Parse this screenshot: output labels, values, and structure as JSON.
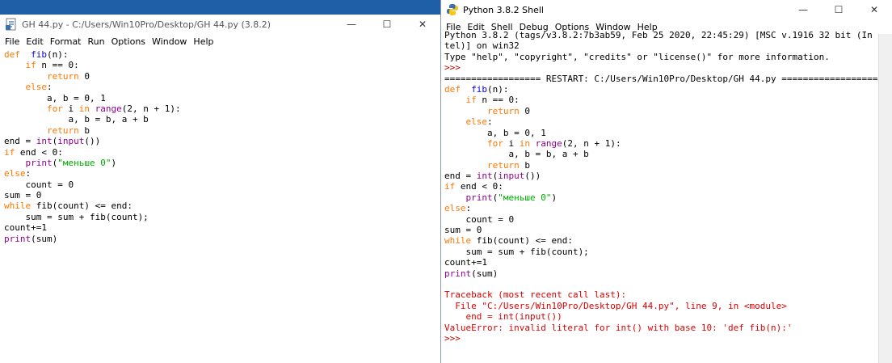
{
  "editor": {
    "title": "GH 44.py - C:/Users/Win10Pro/Desktop/GH 44.py (3.8.2)",
    "menu": [
      "File",
      "Edit",
      "Format",
      "Run",
      "Options",
      "Window",
      "Help"
    ],
    "controls": {
      "minimize": "—",
      "maximize": "☐",
      "close": "✕"
    },
    "code": [
      [
        [
          "kw",
          "def"
        ],
        [
          "",
          "  "
        ],
        [
          "fn",
          "fib"
        ],
        [
          "",
          "(n):"
        ]
      ],
      [
        [
          "",
          "    "
        ],
        [
          "kw",
          "if"
        ],
        [
          "",
          ""
        ],
        [
          "",
          " n == 0:"
        ]
      ],
      [
        [
          "",
          "        "
        ],
        [
          "kw",
          "return"
        ],
        [
          "",
          " 0"
        ]
      ],
      [
        [
          "",
          "    "
        ],
        [
          "kw",
          "else"
        ],
        [
          "",
          ":"
        ]
      ],
      [
        [
          "",
          "        a, b = 0, 1"
        ]
      ],
      [
        [
          "",
          "        "
        ],
        [
          "kw",
          "for"
        ],
        [
          "",
          " i "
        ],
        [
          "kw",
          "in"
        ],
        [
          "",
          " "
        ],
        [
          "bi",
          "range"
        ],
        [
          "",
          "(2, n + 1):"
        ]
      ],
      [
        [
          "",
          "            a, b = b, a + b"
        ]
      ],
      [
        [
          "",
          "        "
        ],
        [
          "kw",
          "return"
        ],
        [
          "",
          " b"
        ]
      ],
      [
        [
          "",
          "end = "
        ],
        [
          "bi",
          "int"
        ],
        [
          "",
          "("
        ],
        [
          "bi",
          "input"
        ],
        [
          "",
          "())"
        ]
      ],
      [
        [
          "kw",
          "if"
        ],
        [
          "",
          " end < 0:"
        ]
      ],
      [
        [
          "",
          "    "
        ],
        [
          "bi",
          "print"
        ],
        [
          "",
          "("
        ],
        [
          "st",
          "\"меньше 0\""
        ],
        [
          "",
          ")"
        ]
      ],
      [
        [
          "kw",
          "else"
        ],
        [
          "",
          ":"
        ]
      ],
      [
        [
          "",
          "    count = 0"
        ]
      ],
      [
        [
          "",
          "sum = 0"
        ]
      ],
      [
        [
          "kw",
          "while"
        ],
        [
          "",
          " fib(count) <= end:"
        ]
      ],
      [
        [
          "",
          "    sum = sum + fib(count);"
        ]
      ],
      [
        [
          "",
          "count+=1"
        ]
      ],
      [
        [
          "bi",
          "print"
        ],
        [
          "",
          "(sum)"
        ]
      ]
    ]
  },
  "shell": {
    "title": "Python 3.8.2 Shell",
    "menu": [
      "File",
      "Edit",
      "Shell",
      "Debug",
      "Options",
      "Window",
      "Help"
    ],
    "controls": {
      "minimize": "—",
      "maximize": "☐",
      "close": "✕"
    },
    "output": [
      [
        [
          "",
          "Python 3.8.2 (tags/v3.8.2:7b3ab59, Feb 25 2020, 22:45:29) [MSC v.1916 32 bit (In"
        ]
      ],
      [
        [
          "",
          "tel)] on win32"
        ]
      ],
      [
        [
          "",
          "Type \"help\", \"copyright\", \"credits\" or \"license()\" for more information."
        ]
      ],
      [
        [
          "pr",
          ">>> "
        ]
      ],
      [
        [
          "",
          "================== RESTART: C:/Users/Win10Pro/Desktop/GH 44.py =================="
        ]
      ],
      [
        [
          "kw",
          "def"
        ],
        [
          "",
          "  "
        ],
        [
          "fn",
          "fib"
        ],
        [
          "",
          "(n):"
        ]
      ],
      [
        [
          "",
          "    "
        ],
        [
          "kw",
          "if"
        ],
        [
          "",
          " n == 0:"
        ]
      ],
      [
        [
          "",
          "        "
        ],
        [
          "kw",
          "return"
        ],
        [
          "",
          " 0"
        ]
      ],
      [
        [
          "",
          "    "
        ],
        [
          "kw",
          "else"
        ],
        [
          "",
          ":"
        ]
      ],
      [
        [
          "",
          "        a, b = 0, 1"
        ]
      ],
      [
        [
          "",
          "        "
        ],
        [
          "kw",
          "for"
        ],
        [
          "",
          " i "
        ],
        [
          "kw",
          "in"
        ],
        [
          "",
          " "
        ],
        [
          "bi",
          "range"
        ],
        [
          "",
          "(2, n + 1):"
        ]
      ],
      [
        [
          "",
          "            a, b = b, a + b"
        ]
      ],
      [
        [
          "",
          "        "
        ],
        [
          "kw",
          "return"
        ],
        [
          "",
          " b"
        ]
      ],
      [
        [
          "",
          "end = "
        ],
        [
          "bi",
          "int"
        ],
        [
          "",
          "("
        ],
        [
          "bi",
          "input"
        ],
        [
          "",
          "())"
        ]
      ],
      [
        [
          "kw",
          "if"
        ],
        [
          "",
          " end < 0:"
        ]
      ],
      [
        [
          "",
          "    "
        ],
        [
          "bi",
          "print"
        ],
        [
          "",
          "("
        ],
        [
          "st",
          "\"меньше 0\""
        ],
        [
          "",
          ")"
        ]
      ],
      [
        [
          "kw",
          "else"
        ],
        [
          "",
          ":"
        ]
      ],
      [
        [
          "",
          "    count = 0"
        ]
      ],
      [
        [
          "",
          "sum = 0"
        ]
      ],
      [
        [
          "kw",
          "while"
        ],
        [
          "",
          " fib(count) <= end:"
        ]
      ],
      [
        [
          "",
          "    sum = sum + fib(count);"
        ]
      ],
      [
        [
          "",
          "count+=1"
        ]
      ],
      [
        [
          "bi",
          "print"
        ],
        [
          "",
          "(sum)"
        ]
      ],
      [
        [
          "",
          ""
        ]
      ],
      [
        [
          "er",
          "Traceback (most recent call last):"
        ]
      ],
      [
        [
          "er",
          "  File \"C:/Users/Win10Pro/Desktop/GH 44.py\", line 9, in <module>"
        ]
      ],
      [
        [
          "er",
          "    end = int(input())"
        ]
      ],
      [
        [
          "er",
          "ValueError: invalid literal for int() with base 10: 'def fib(n):'"
        ]
      ],
      [
        [
          "pr",
          ">>> "
        ]
      ]
    ]
  }
}
